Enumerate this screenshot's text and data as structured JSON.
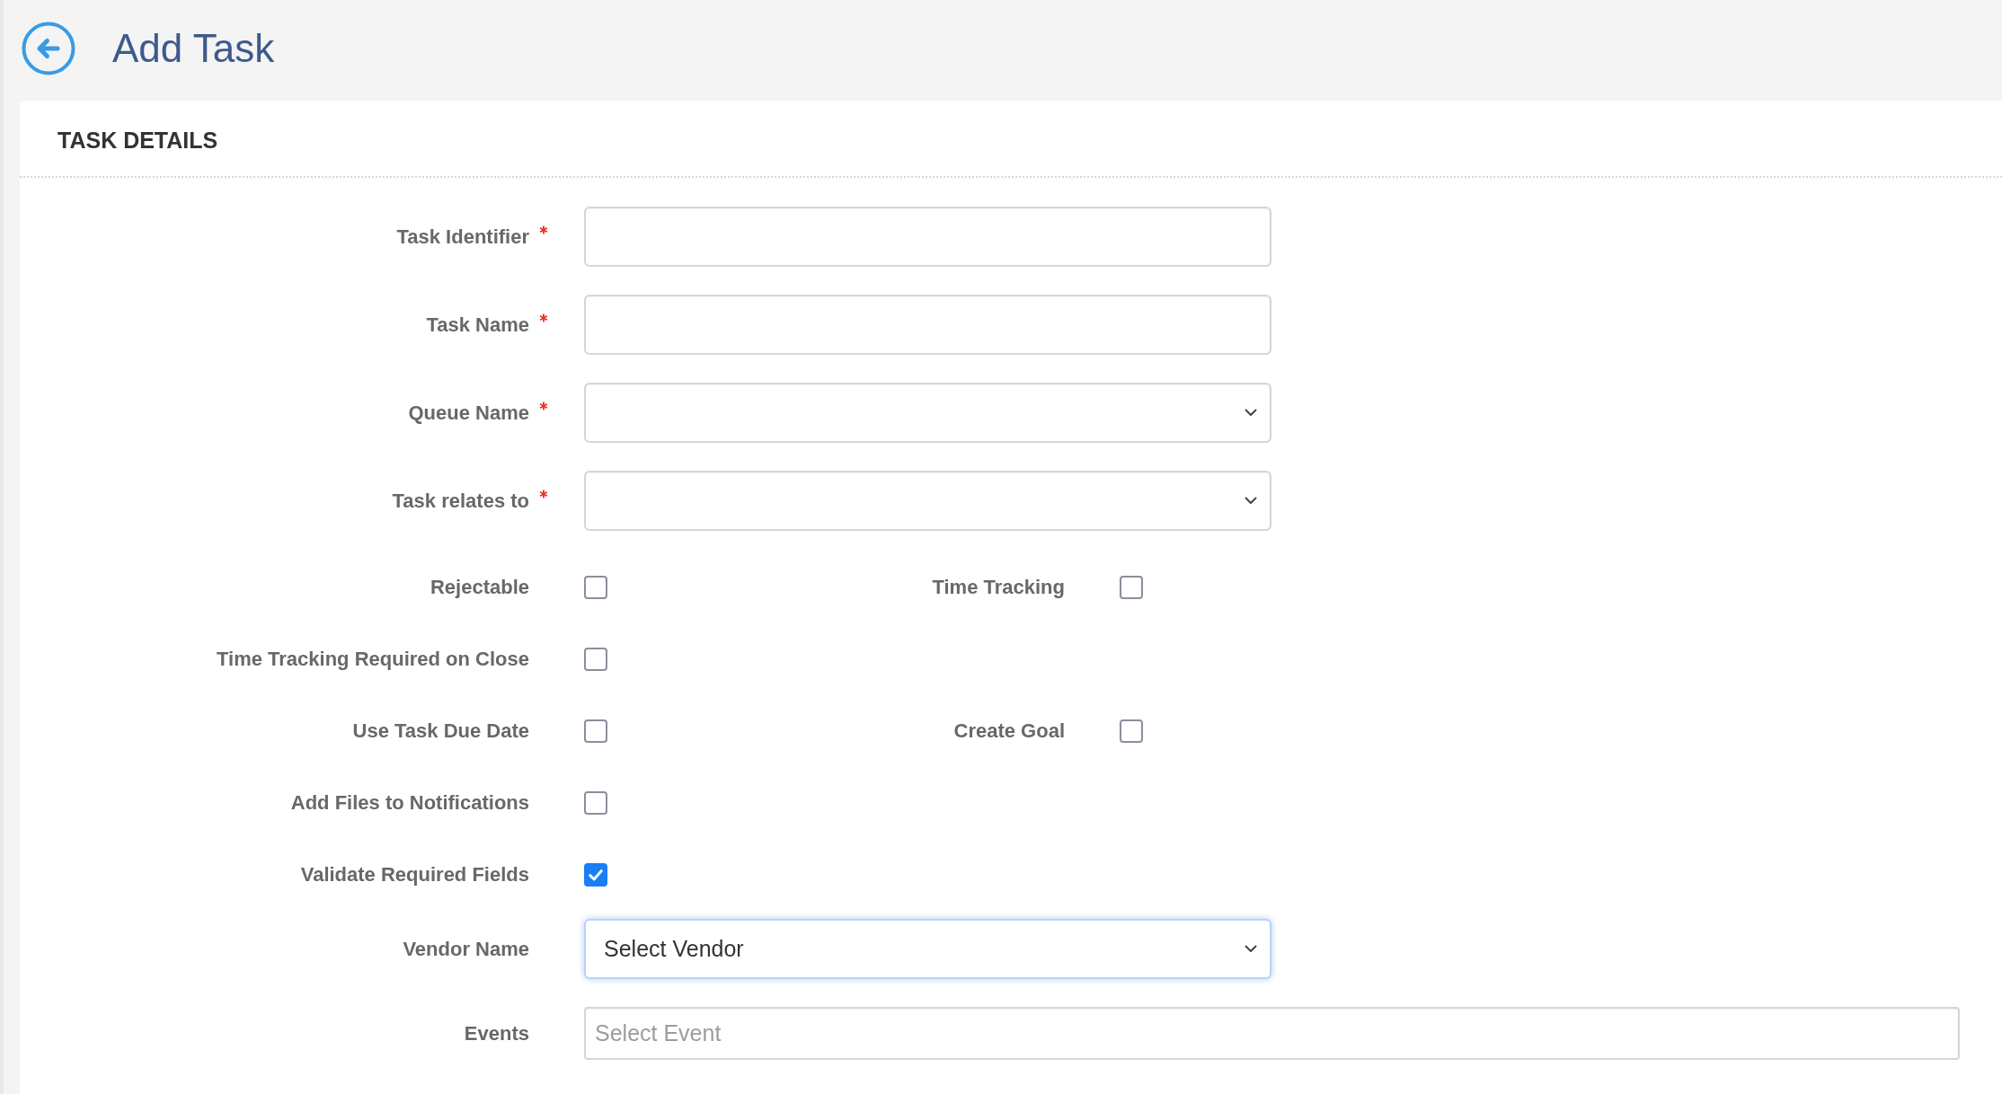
{
  "header": {
    "title": "Add Task"
  },
  "section": {
    "title": "TASK DETAILS"
  },
  "fields": [
    {
      "label": "Task Identifier",
      "kind": "text",
      "required": true,
      "focused": false
    },
    {
      "label": "Task Name",
      "kind": "text",
      "required": true,
      "focused": false
    },
    {
      "label": "Queue Name",
      "kind": "select",
      "required": true,
      "focused": false
    },
    {
      "label": "Task relates to",
      "kind": "select",
      "required": true,
      "focused": false
    }
  ],
  "options": [
    {
      "cells": [
        {
          "label": "Rejectable",
          "checked": false
        },
        {
          "label": "Time Tracking",
          "checked": false
        }
      ]
    },
    {
      "cells": [
        {
          "label": "Time Tracking Required on Close",
          "checked": false
        }
      ]
    },
    {
      "cells": [
        {
          "label": "Use Task Due Date",
          "checked": false
        },
        {
          "label": "Create Goal",
          "checked": false
        }
      ]
    },
    {
      "cells": [
        {
          "label": "Add Files to Notifications",
          "checked": false
        }
      ]
    },
    {
      "cells": [
        {
          "label": "Validate Required Fields",
          "checked": true
        }
      ]
    }
  ],
  "more_fields": [
    {
      "label": "Vendor Name",
      "kind": "select",
      "required": false,
      "focused": true,
      "value": "Select Vendor"
    },
    {
      "label": "Events",
      "kind": "multiselect",
      "required": false,
      "focused": false,
      "placeholder": "Select Event"
    }
  ]
}
